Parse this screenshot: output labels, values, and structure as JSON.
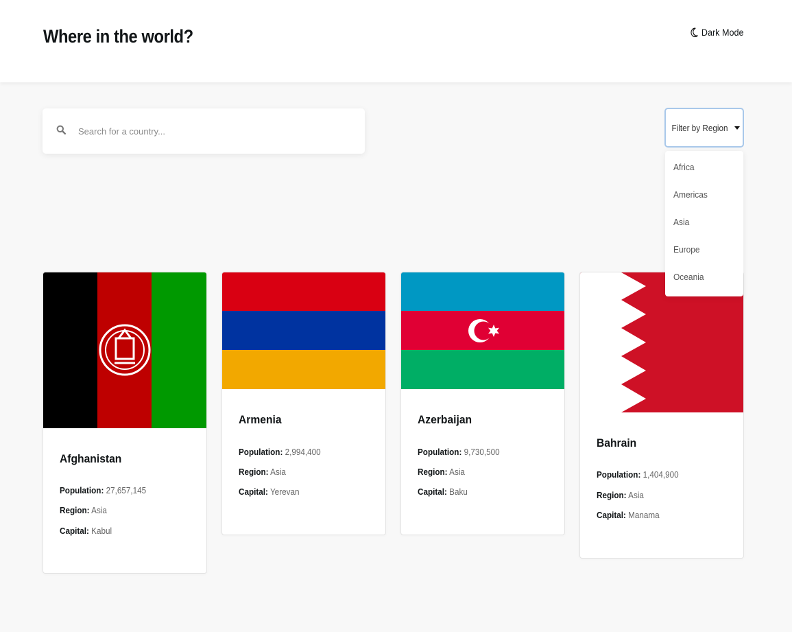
{
  "header": {
    "title": "Where in the world?",
    "dark_mode_label": "Dark Mode",
    "dark_mode_icon": "moon-icon"
  },
  "search": {
    "placeholder": "Search for a country...",
    "value": "",
    "icon": "search-icon"
  },
  "filter": {
    "label": "Filter by Region",
    "options": [
      "Africa",
      "Americas",
      "Asia",
      "Europe",
      "Oceania"
    ]
  },
  "labels": {
    "population": "Population:",
    "region": "Region:",
    "capital": "Capital:"
  },
  "countries": [
    {
      "name": "Afghanistan",
      "population": "27,657,145",
      "region": "Asia",
      "capital": "Kabul",
      "flag_colors": [
        "#000000",
        "#be0000",
        "#009900"
      ]
    },
    {
      "name": "Armenia",
      "population": "2,994,400",
      "region": "Asia",
      "capital": "Yerevan",
      "flag_colors": [
        "#d90012",
        "#0033a0",
        "#f2a800"
      ]
    },
    {
      "name": "Azerbaijan",
      "population": "9,730,500",
      "region": "Asia",
      "capital": "Baku",
      "flag_colors": [
        "#0098c3",
        "#e00034",
        "#00ae65"
      ]
    },
    {
      "name": "Bahrain",
      "population": "1,404,900",
      "region": "Asia",
      "capital": "Manama",
      "flag_colors": [
        "#ffffff",
        "#ce1126"
      ]
    }
  ]
}
